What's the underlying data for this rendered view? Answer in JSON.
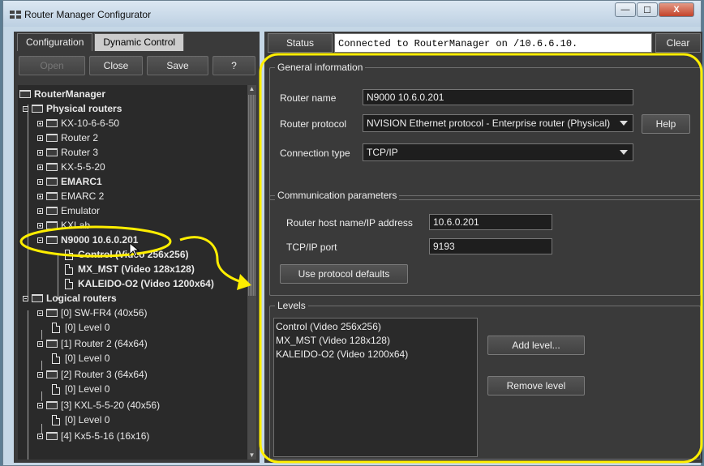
{
  "window": {
    "title": "Router Manager Configurator",
    "min": "—",
    "max": "☐",
    "close": "X"
  },
  "left_panel": {
    "tabs": [
      "Configuration",
      "Dynamic Control"
    ],
    "toolbar": {
      "open": "Open",
      "close": "Close",
      "save": "Save",
      "help": "?"
    },
    "tree": {
      "root": "RouterManager",
      "physical": "Physical routers",
      "physical_items": [
        "KX-10-6-6-50",
        "Router 2",
        "Router 3",
        "KX-5-5-20",
        "EMARC1",
        "EMARC 2",
        "Emulator",
        "KXLab",
        "N9000 10.6.0.201"
      ],
      "n9000_children": [
        "Control (Video 256x256)",
        "MX_MST (Video 128x128)",
        "KALEIDO-O2 (Video 1200x64)"
      ],
      "logical": "Logical routers",
      "logical_items": [
        "[0] SW-FR4 (40x56)",
        "[1] Router 2 (64x64)",
        "[2] Router 3 (64x64)",
        "[3] KXL-5-5-20 (40x56)",
        "[4] Kx5-5-16 (16x16)"
      ],
      "level0": "[0] Level 0"
    }
  },
  "right_panel": {
    "status_label": "Status",
    "status_text": "Connected to RouterManager on /10.6.6.10.",
    "clear": "Clear",
    "general": {
      "title": "General information",
      "router_name_label": "Router name",
      "router_name": "N9000 10.6.0.201",
      "protocol_label": "Router protocol",
      "protocol": "NVISION Ethernet protocol - Enterprise router (Physical)",
      "help": "Help",
      "connection_label": "Connection type",
      "connection": "TCP/IP"
    },
    "comm": {
      "title": "Communication parameters",
      "host_label": "Router host name/IP address",
      "host": "10.6.0.201",
      "port_label": "TCP/IP port",
      "port": "9193",
      "defaults": "Use protocol defaults"
    },
    "levels": {
      "title": "Levels",
      "items": [
        "Control (Video 256x256)",
        "MX_MST (Video 128x128)",
        "KALEIDO-O2 (Video 1200x64)"
      ],
      "add": "Add level...",
      "remove": "Remove level"
    }
  },
  "colors": {
    "highlight": "#ffee00",
    "panel": "#3a3a3a",
    "titlebar": "#c5d7e6"
  }
}
